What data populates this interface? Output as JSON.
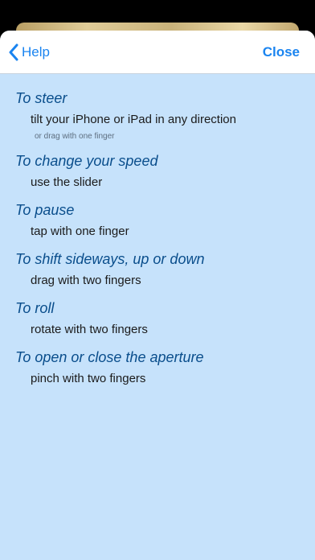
{
  "nav": {
    "back_label": "Help",
    "close_label": "Close"
  },
  "sections": [
    {
      "heading": "To steer",
      "description": "tilt your iPhone or iPad in any direction",
      "note": "or drag with one finger"
    },
    {
      "heading": "To change your speed",
      "description": "use the slider"
    },
    {
      "heading": "To pause",
      "description": "tap with one finger"
    },
    {
      "heading": "To shift sideways, up or down",
      "description": "drag with two fingers"
    },
    {
      "heading": "To roll",
      "description": "rotate with two fingers"
    },
    {
      "heading": "To open or close the aperture",
      "description": "pinch with two fingers"
    }
  ],
  "colors": {
    "accent": "#1a84f0",
    "heading": "#0a4e8c",
    "sheet_background": "#c6e2fb"
  },
  "icons": {
    "back": "chevron-left-icon"
  }
}
